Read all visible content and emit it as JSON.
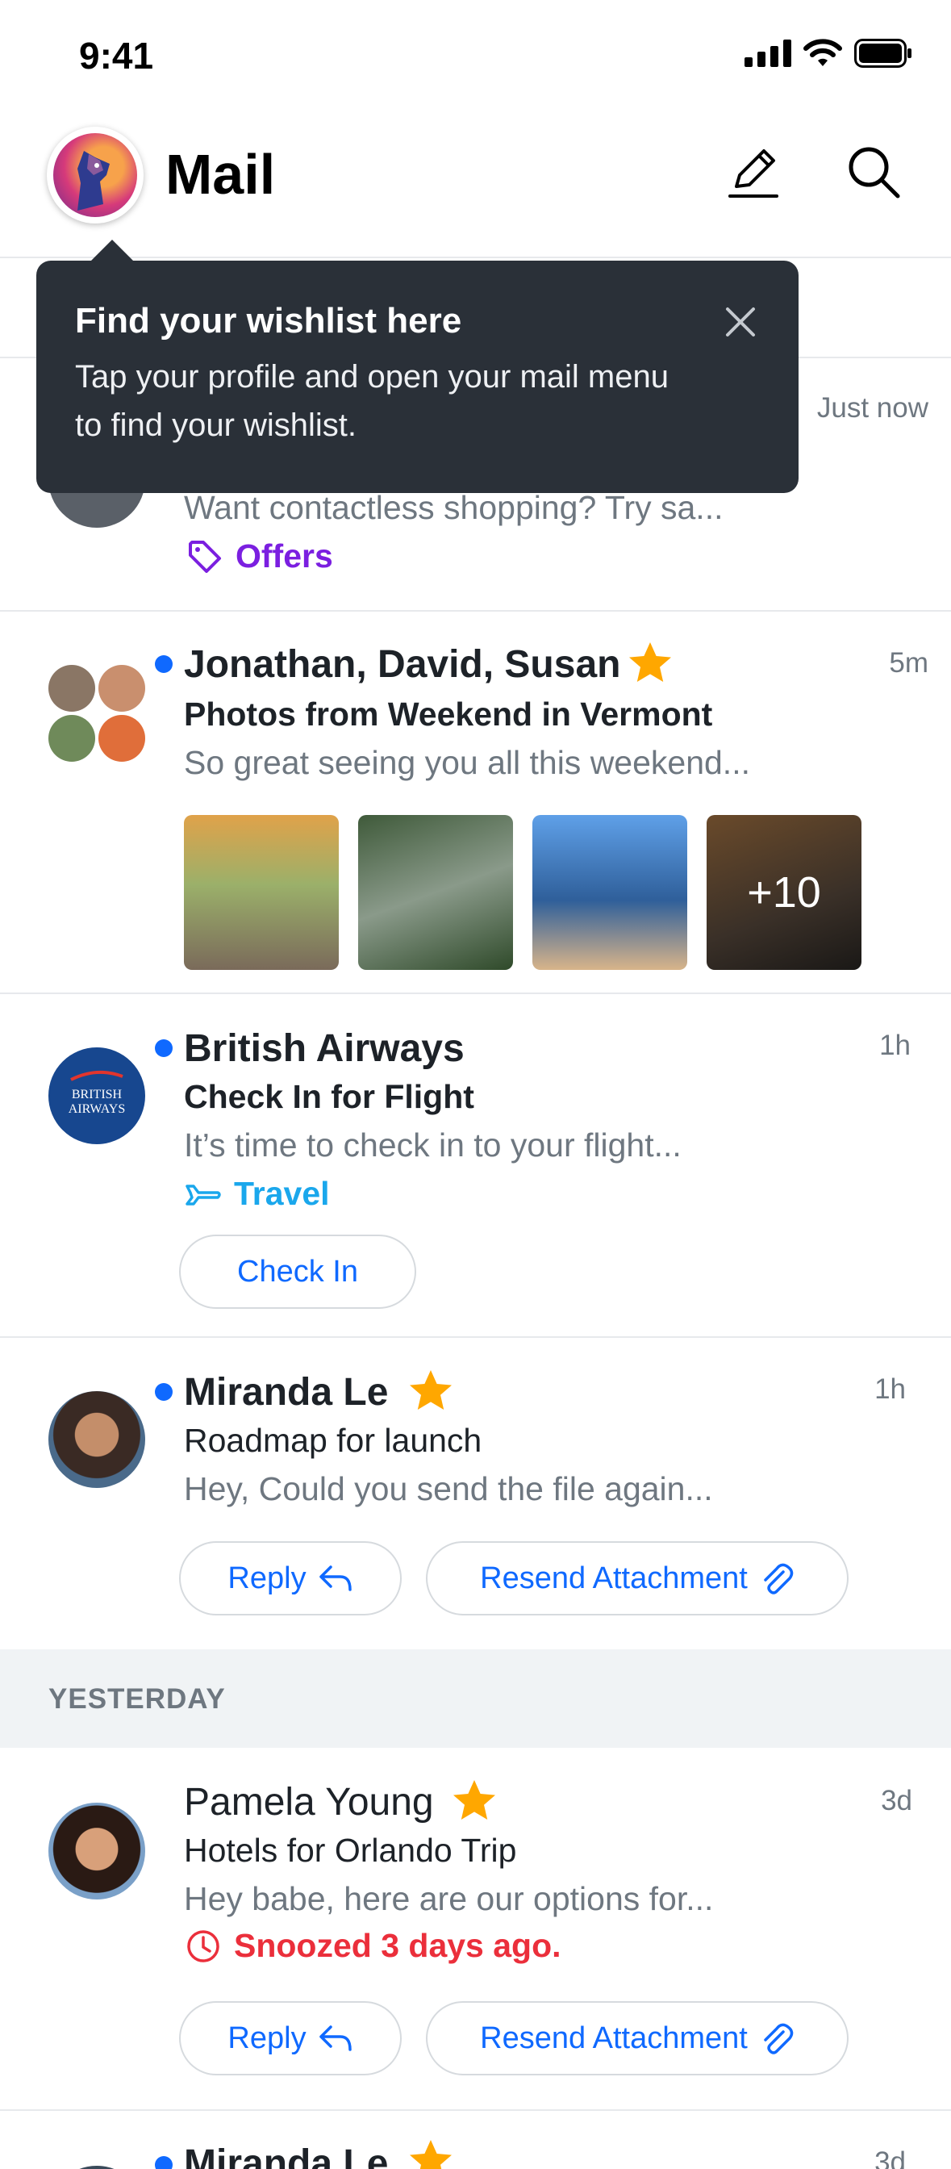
{
  "status_bar": {
    "time": "9:41"
  },
  "header": {
    "title": "Mail"
  },
  "tooltip": {
    "title": "Find your wishlist here",
    "body": "Tap your profile and open your mail menu to find your wishlist."
  },
  "emails": [
    {
      "time": "Just now",
      "snippet": "Want contactless shopping? Try sa...",
      "label": "Offers"
    },
    {
      "sender": "Jonathan, David, Susan",
      "subject": "Photos from Weekend in Vermont",
      "snippet": "So great seeing you all this weekend...",
      "time": "5m",
      "more_photos": "+10",
      "unread": true,
      "starred": true
    },
    {
      "sender": "British Airways",
      "avatar_text": "BRITISH AIRWAYS",
      "subject": "Check In for Flight",
      "snippet": "It’s time to check in to your flight...",
      "time": "1h",
      "label": "Travel",
      "action": "Check In",
      "unread": true
    },
    {
      "sender": "Miranda Le",
      "subject": "Roadmap for launch",
      "snippet": "Hey, Could you send the file again...",
      "time": "1h",
      "actions": [
        "Reply",
        "Resend Attachment"
      ],
      "unread": true,
      "starred": true
    },
    {
      "sender": "Pamela Young",
      "subject": "Hotels for Orlando Trip",
      "snippet": "Hey babe, here are our options for...",
      "time": "3d",
      "snooze_text": "Snoozed 3 days ago.",
      "actions": [
        "Reply",
        "Resend Attachment"
      ],
      "starred": true
    },
    {
      "sender": "Miranda Le",
      "time": "3d",
      "unread": true,
      "starred": true
    }
  ],
  "section_header": "YESTERDAY",
  "colors": {
    "accent": "#0f69ff",
    "offers": "#7b1fe0",
    "travel": "#1aa7ec",
    "snoozed": "#eb2f3b",
    "star": "#ffa700",
    "tooltip_bg": "#2a3038"
  }
}
